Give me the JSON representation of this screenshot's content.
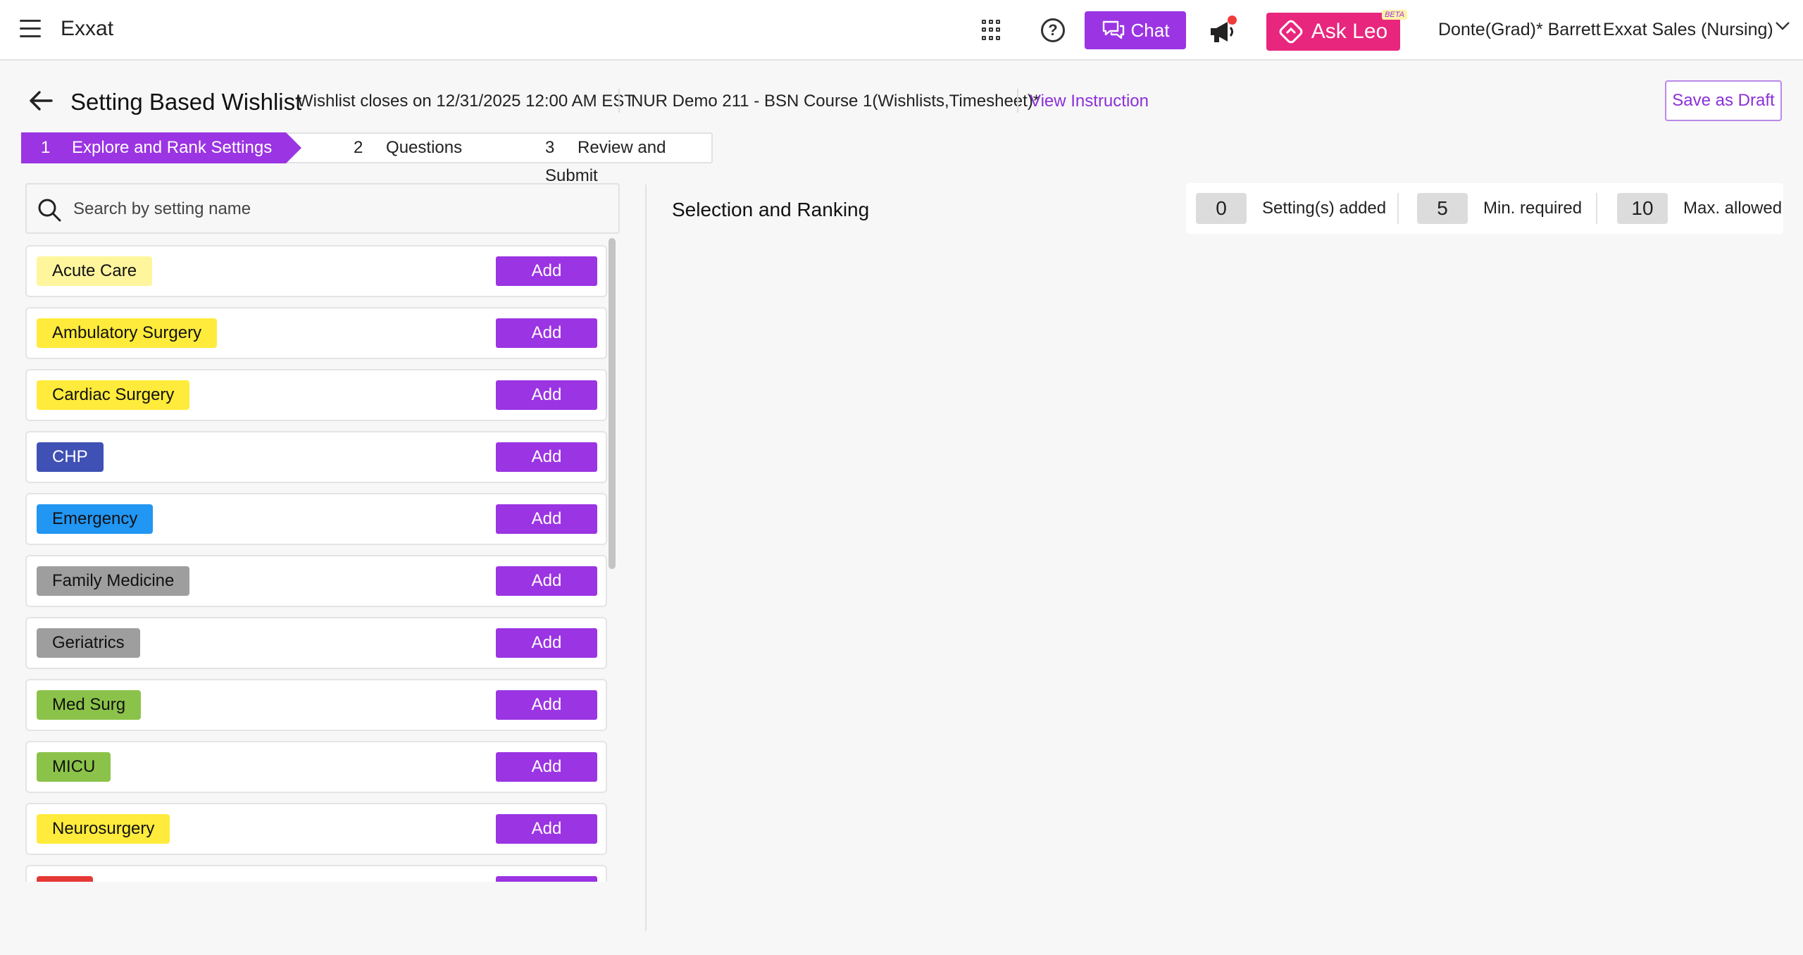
{
  "header": {
    "brand": "Exxat",
    "chat_label": "Chat",
    "ask_leo_label": "Ask Leo",
    "ask_leo_badge": "BETA",
    "user_name": "Donte(Grad)* Barrett",
    "org_name": "Exxat Sales (Nursing)",
    "icons": [
      "menu-icon",
      "apps-grid-icon",
      "help-icon",
      "chat-bubbles-icon",
      "megaphone-icon",
      "ask-leo-icon",
      "chevron-down-icon"
    ]
  },
  "subheader": {
    "title": "Setting Based Wishlist",
    "close_info": "Wishlist closes on 12/31/2025 12:00 AM EST",
    "course_info": "NUR Demo 211 - BSN Course 1(Wishlists,Timesheet)*",
    "view_instruction": "View Instruction",
    "save_draft": "Save as Draft"
  },
  "stepper": {
    "steps": [
      {
        "num": "1",
        "label": "Explore and Rank Settings",
        "active": true
      },
      {
        "num": "2",
        "label": "Questions",
        "active": false
      },
      {
        "num": "3",
        "label": "Review and Submit",
        "active": false
      }
    ]
  },
  "search": {
    "placeholder": "Search by setting name",
    "value": ""
  },
  "settings": {
    "add_label": "Add",
    "items": [
      {
        "label": "Acute Care",
        "color": "#fff59d"
      },
      {
        "label": "Ambulatory Surgery",
        "color": "#ffeb3b"
      },
      {
        "label": "Cardiac Surgery",
        "color": "#ffeb3b"
      },
      {
        "label": "CHP",
        "color": "#3f51b5",
        "text_color": "#ffffff"
      },
      {
        "label": "Emergency",
        "color": "#2196f3"
      },
      {
        "label": "Family Medicine",
        "color": "#9e9e9e"
      },
      {
        "label": "Geriatrics",
        "color": "#9e9e9e"
      },
      {
        "label": "Med Surg",
        "color": "#8bc34a"
      },
      {
        "label": "MICU",
        "color": "#8bc34a"
      },
      {
        "label": "Neurosurgery",
        "color": "#ffeb3b"
      }
    ],
    "partial_next_color": "#e53935"
  },
  "selection": {
    "title": "Selection and Ranking",
    "added_count": "0",
    "added_label": "Setting(s) added",
    "min_count": "5",
    "min_label": "Min. required",
    "max_count": "10",
    "max_label": "Max. allowed"
  },
  "colors": {
    "accent": "#9b34e3",
    "ask_leo": "#e8267d",
    "link": "#8b2fd9"
  }
}
